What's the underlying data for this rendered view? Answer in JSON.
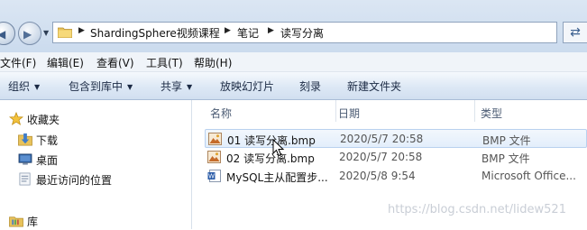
{
  "address_bar": {
    "crumbs": [
      "ShardingSphere视频课程",
      "笔记",
      "读写分离"
    ]
  },
  "menu": [
    "文件(F)",
    "编辑(E)",
    "查看(V)",
    "工具(T)",
    "帮助(H)"
  ],
  "toolbar": {
    "organize": "组织",
    "include_in_library": "包含到库中",
    "share": "共享",
    "slideshow": "放映幻灯片",
    "burn": "刻录",
    "new_folder": "新建文件夹"
  },
  "nav_pane": {
    "favorites": "收藏夹",
    "downloads": "下载",
    "desktop": "桌面",
    "recent": "最近访问的位置",
    "libraries": "库"
  },
  "file_list": {
    "columns": {
      "name": "名称",
      "date": "日期",
      "type": "类型"
    },
    "rows": [
      {
        "name": "01 读写分离.bmp",
        "date": "2020/5/7 20:58",
        "type": "BMP 文件",
        "icon": "bmp-image-icon"
      },
      {
        "name": "02 读写分离.bmp",
        "date": "2020/5/7 20:58",
        "type": "BMP 文件",
        "icon": "bmp-image-icon"
      },
      {
        "name": "MySQL主从配置步...",
        "date": "2020/5/8 9:54",
        "type": "Microsoft Office...",
        "icon": "word-document-icon"
      }
    ]
  },
  "watermark": "https://blog.csdn.net/lidew521",
  "colors": {
    "toolbar_gradient_top": "#f5f9fd",
    "toolbar_gradient_bottom": "#d1dff0",
    "selection_border": "#b9d1ef",
    "folder_yellow": "#e8c25a"
  }
}
